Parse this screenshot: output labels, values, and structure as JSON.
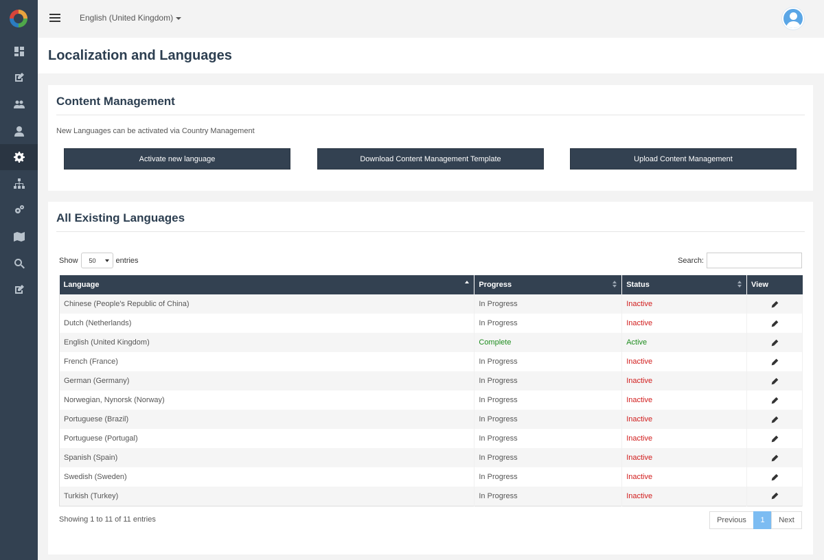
{
  "topbar": {
    "language": "English (United Kingdom)"
  },
  "page": {
    "title": "Localization and Languages"
  },
  "sidebar": {
    "items": [
      {
        "icon": "dashboard-icon",
        "active": false
      },
      {
        "icon": "edit-icon",
        "active": false
      },
      {
        "icon": "users-icon",
        "active": false
      },
      {
        "icon": "user-icon",
        "active": false
      },
      {
        "icon": "gear-icon",
        "active": true
      },
      {
        "icon": "sitemap-icon",
        "active": false
      },
      {
        "icon": "gears-icon",
        "active": false
      },
      {
        "icon": "map-icon",
        "active": false
      },
      {
        "icon": "search-icon",
        "active": false
      },
      {
        "icon": "edit-icon",
        "active": false
      }
    ]
  },
  "content_management": {
    "heading": "Content Management",
    "info": "New Languages can be activated via Country Management",
    "buttons": {
      "activate": "Activate new language",
      "download": "Download Content Management Template",
      "upload": "Upload Content Management"
    }
  },
  "languages_panel": {
    "heading": "All Existing Languages",
    "show_label": "Show",
    "entries_value": "50",
    "entries_label": "entries",
    "search_label": "Search:",
    "search_value": "",
    "columns": [
      "Language",
      "Progress",
      "Status",
      "View"
    ],
    "rows": [
      {
        "language": "Chinese (People's Republic of China)",
        "progress": "In Progress",
        "status": "Inactive"
      },
      {
        "language": "Dutch (Netherlands)",
        "progress": "In Progress",
        "status": "Inactive"
      },
      {
        "language": "English (United Kingdom)",
        "progress": "Complete",
        "status": "Active"
      },
      {
        "language": "French (France)",
        "progress": "In Progress",
        "status": "Inactive"
      },
      {
        "language": "German (Germany)",
        "progress": "In Progress",
        "status": "Inactive"
      },
      {
        "language": "Norwegian, Nynorsk (Norway)",
        "progress": "In Progress",
        "status": "Inactive"
      },
      {
        "language": "Portuguese (Brazil)",
        "progress": "In Progress",
        "status": "Inactive"
      },
      {
        "language": "Portuguese (Portugal)",
        "progress": "In Progress",
        "status": "Inactive"
      },
      {
        "language": "Spanish (Spain)",
        "progress": "In Progress",
        "status": "Inactive"
      },
      {
        "language": "Swedish (Sweden)",
        "progress": "In Progress",
        "status": "Inactive"
      },
      {
        "language": "Turkish (Turkey)",
        "progress": "In Progress",
        "status": "Inactive"
      }
    ],
    "showing_text": "Showing 1 to 11 of 11 entries",
    "pagination": {
      "previous": "Previous",
      "current": "1",
      "next": "Next"
    }
  },
  "colors": {
    "sidebar": "#334151",
    "active_status": "#1e8c1e",
    "inactive_status": "#d11c1c",
    "current_page": "#7cbcf2"
  }
}
